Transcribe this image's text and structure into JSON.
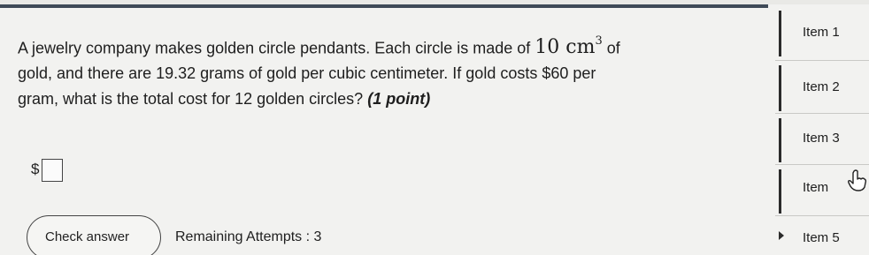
{
  "question": {
    "line1_before": "A jewelry company makes golden circle pendants. Each circle is made of",
    "math_value": "10 cm",
    "math_exp": "3",
    "line1_after": "of",
    "line2": "gold, and there are 19.32 grams of gold per cubic centimeter. If gold costs $60 per",
    "line3_text": "gram, what is the total cost for 12 golden circles?",
    "points": "(1 point)"
  },
  "answer": {
    "currency": "$",
    "value": ""
  },
  "footer": {
    "check_label": "Check answer",
    "attempts": "Remaining Attempts : 3"
  },
  "item_nav": {
    "items": [
      {
        "label": "Item 1"
      },
      {
        "label": "Item 2"
      },
      {
        "label": "Item 3"
      },
      {
        "label": "Item"
      },
      {
        "label": "Item 5"
      }
    ],
    "current_index": 4
  },
  "colors": {
    "top_bar": "#3f4a57",
    "background": "#f2f2f0",
    "text": "#1e1e1e"
  },
  "icons": {
    "pointer": "hand-pointer-icon",
    "current_item": "arrow-right-icon"
  }
}
